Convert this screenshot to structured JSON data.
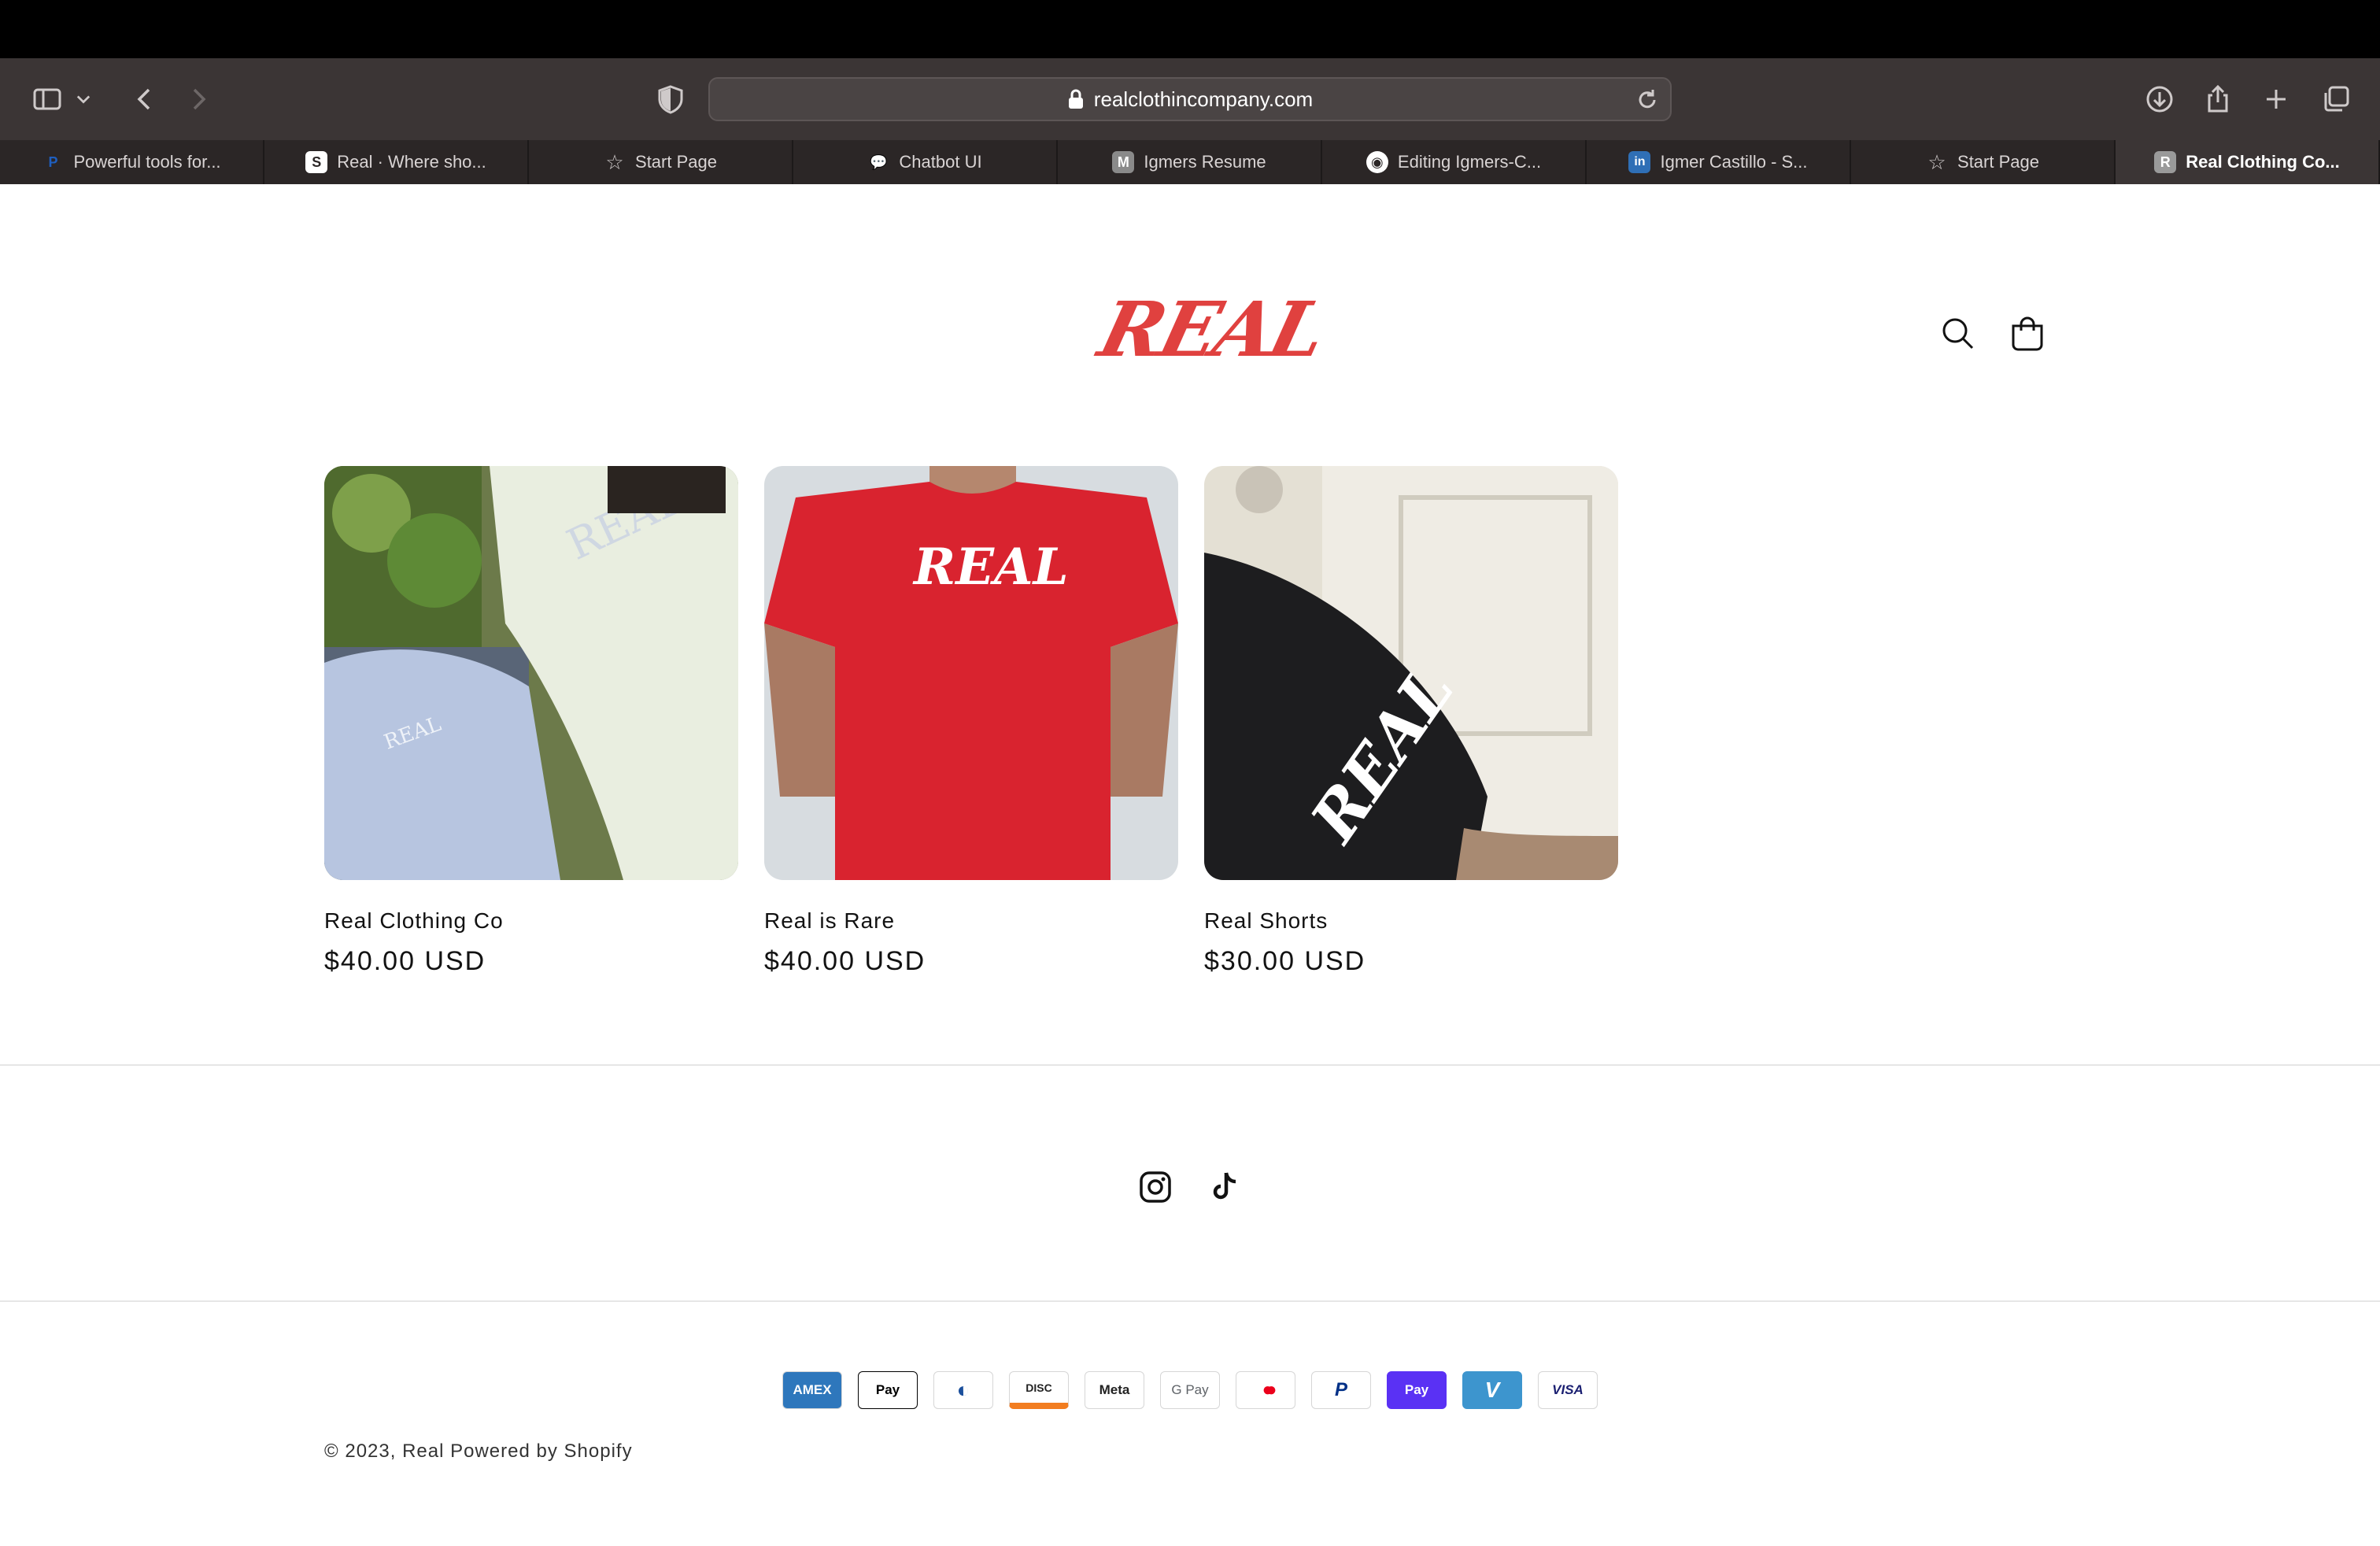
{
  "browser": {
    "url": "realclothincompany.com",
    "tabs": [
      {
        "label": "Powerful tools for...",
        "icon": "paypal-icon",
        "badge": "P",
        "color": "#1f5fbf"
      },
      {
        "label": "Real · Where sho...",
        "icon": "shopify-icon",
        "badge": "S",
        "color": "#ffffff"
      },
      {
        "label": "Start Page",
        "icon": "star-icon",
        "badge": "☆",
        "color": "#cfcaca"
      },
      {
        "label": "Chatbot UI",
        "icon": "chat-icon",
        "badge": "💬",
        "color": "#8fc1ff"
      },
      {
        "label": "Igmers Resume",
        "icon": "m-icon",
        "badge": "M",
        "color": "#8a8a8a"
      },
      {
        "label": "Editing Igmers-C...",
        "icon": "github-icon",
        "badge": "◉",
        "color": "#ffffff"
      },
      {
        "label": "Igmer Castillo - S...",
        "icon": "linkedin-icon",
        "badge": "in",
        "color": "#2f6fb6"
      },
      {
        "label": "Start Page",
        "icon": "star-icon",
        "badge": "☆",
        "color": "#cfcaca"
      },
      {
        "label": "Real Clothing Co...",
        "icon": "r-icon",
        "badge": "R",
        "color": "#9a9a9a"
      }
    ]
  },
  "header": {
    "logo_text": "REAL",
    "logo_color": "#e0413f"
  },
  "products": [
    {
      "title": "Real Clothing Co",
      "price": "$40.00 USD"
    },
    {
      "title": "Real is Rare",
      "price": "$40.00 USD"
    },
    {
      "title": "Real Shorts",
      "price": "$30.00 USD"
    }
  ],
  "social": [
    "instagram-icon",
    "tiktok-icon"
  ],
  "payments": [
    {
      "name": "amex",
      "label": "AMEX",
      "bg": "#2e77bc",
      "fg": "#ffffff"
    },
    {
      "name": "apple-pay",
      "label": "Pay",
      "bg": "#ffffff",
      "fg": "#000000"
    },
    {
      "name": "diners",
      "label": "◐",
      "bg": "#ffffff",
      "fg": "#1b4f9c"
    },
    {
      "name": "discover",
      "label": "DISC",
      "bg": "#ffffff",
      "fg": "#222222"
    },
    {
      "name": "meta",
      "label": "Meta",
      "bg": "#ffffff",
      "fg": "#222222"
    },
    {
      "name": "google-pay",
      "label": "G Pay",
      "bg": "#ffffff",
      "fg": "#5f6368"
    },
    {
      "name": "mastercard",
      "label": "●●",
      "bg": "#ffffff",
      "fg": "#eb001b"
    },
    {
      "name": "paypal",
      "label": "P",
      "bg": "#ffffff",
      "fg": "#003087"
    },
    {
      "name": "shop-pay",
      "label": "Pay",
      "bg": "#5a31f4",
      "fg": "#ffffff"
    },
    {
      "name": "venmo",
      "label": "V",
      "bg": "#3d95ce",
      "fg": "#ffffff"
    },
    {
      "name": "visa",
      "label": "VISA",
      "bg": "#ffffff",
      "fg": "#1a1f71"
    }
  ],
  "footer": {
    "copyright": "© 2023, Real Powered by Shopify"
  }
}
